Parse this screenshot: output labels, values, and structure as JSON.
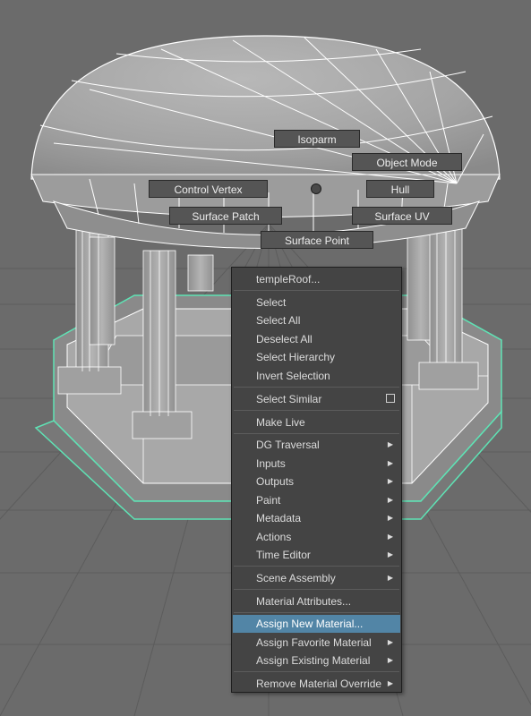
{
  "marking_menu": {
    "isoparm": "Isoparm",
    "object_mode": "Object Mode",
    "control_vertex": "Control Vertex",
    "hull": "Hull",
    "surface_patch": "Surface Patch",
    "surface_uv": "Surface UV",
    "surface_point": "Surface Point"
  },
  "context_menu": {
    "header": "templeRoof...",
    "items": [
      {
        "label": "Select"
      },
      {
        "label": "Select All"
      },
      {
        "label": "Deselect All"
      },
      {
        "label": "Select Hierarchy"
      },
      {
        "label": "Invert Selection"
      },
      {
        "label": "Select Similar",
        "option_box": true
      },
      {
        "label": "Make Live"
      },
      {
        "label": "DG Traversal",
        "submenu": true
      },
      {
        "label": "Inputs",
        "submenu": true
      },
      {
        "label": "Outputs",
        "submenu": true
      },
      {
        "label": "Paint",
        "submenu": true
      },
      {
        "label": "Metadata",
        "submenu": true
      },
      {
        "label": "Actions",
        "submenu": true
      },
      {
        "label": "Time Editor",
        "submenu": true
      },
      {
        "label": "Scene Assembly",
        "submenu": true
      },
      {
        "label": "Material Attributes..."
      },
      {
        "label": "Assign New Material...",
        "highlighted": true
      },
      {
        "label": "Assign Favorite Material",
        "submenu": true
      },
      {
        "label": "Assign Existing Material",
        "submenu": true
      },
      {
        "label": "Remove Material Override",
        "submenu": true
      }
    ]
  },
  "colors": {
    "viewport_bg": "#6b6b6b",
    "menu_bg": "#444444",
    "highlight": "#5285a6",
    "selection_green": "#5fe3b5"
  }
}
